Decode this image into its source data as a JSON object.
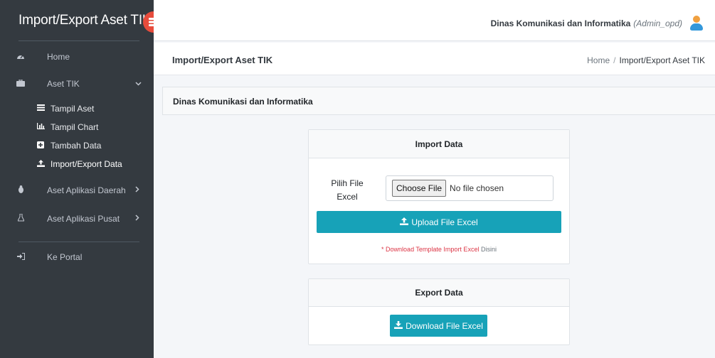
{
  "app": {
    "brand": "Import/Export Aset TIK",
    "brand_icon": "server-icon"
  },
  "topbar": {
    "user_name": "Dinas Komunikasi dan Informatika",
    "user_role": "(Admin_opd)"
  },
  "sidebar": {
    "items": [
      {
        "label": "Home",
        "icon": "dashboard-icon"
      },
      {
        "label": "Aset TIK",
        "icon": "briefcase-icon",
        "expanded": true
      },
      {
        "label": "Aset Aplikasi Daerah",
        "icon": "bug-icon"
      },
      {
        "label": "Aset Aplikasi Pusat",
        "icon": "flask-icon"
      },
      {
        "label": "Ke Portal",
        "icon": "sign-in-icon"
      }
    ],
    "sub_items": [
      {
        "label": "Tampil Aset",
        "icon": "list-icon"
      },
      {
        "label": "Tampil Chart",
        "icon": "bar-chart-icon"
      },
      {
        "label": "Tambah Data",
        "icon": "plus-square-icon"
      },
      {
        "label": "Import/Export Data",
        "icon": "upload-icon",
        "active": true
      }
    ]
  },
  "header": {
    "title": "Import/Export Aset TIK",
    "breadcrumb": [
      "Home",
      "Import/Export Aset TIK"
    ]
  },
  "main": {
    "card_title": "Dinas Komunikasi dan Informatika",
    "import": {
      "title": "Import Data",
      "file_label": "Pilih File Excel",
      "choose_button": "Choose File",
      "no_file": "No file chosen",
      "upload_button": "Upload File Excel",
      "note_prefix": "*",
      "note_link": "Download Template Import Excel",
      "note_suffix": "Disini"
    },
    "export": {
      "title": "Export Data",
      "download_button": "Download File Excel"
    }
  },
  "colors": {
    "sidebar_bg": "#343a40",
    "accent": "#17a2b8",
    "brand_logo": "#e74c3c",
    "required": "#dc3545"
  }
}
